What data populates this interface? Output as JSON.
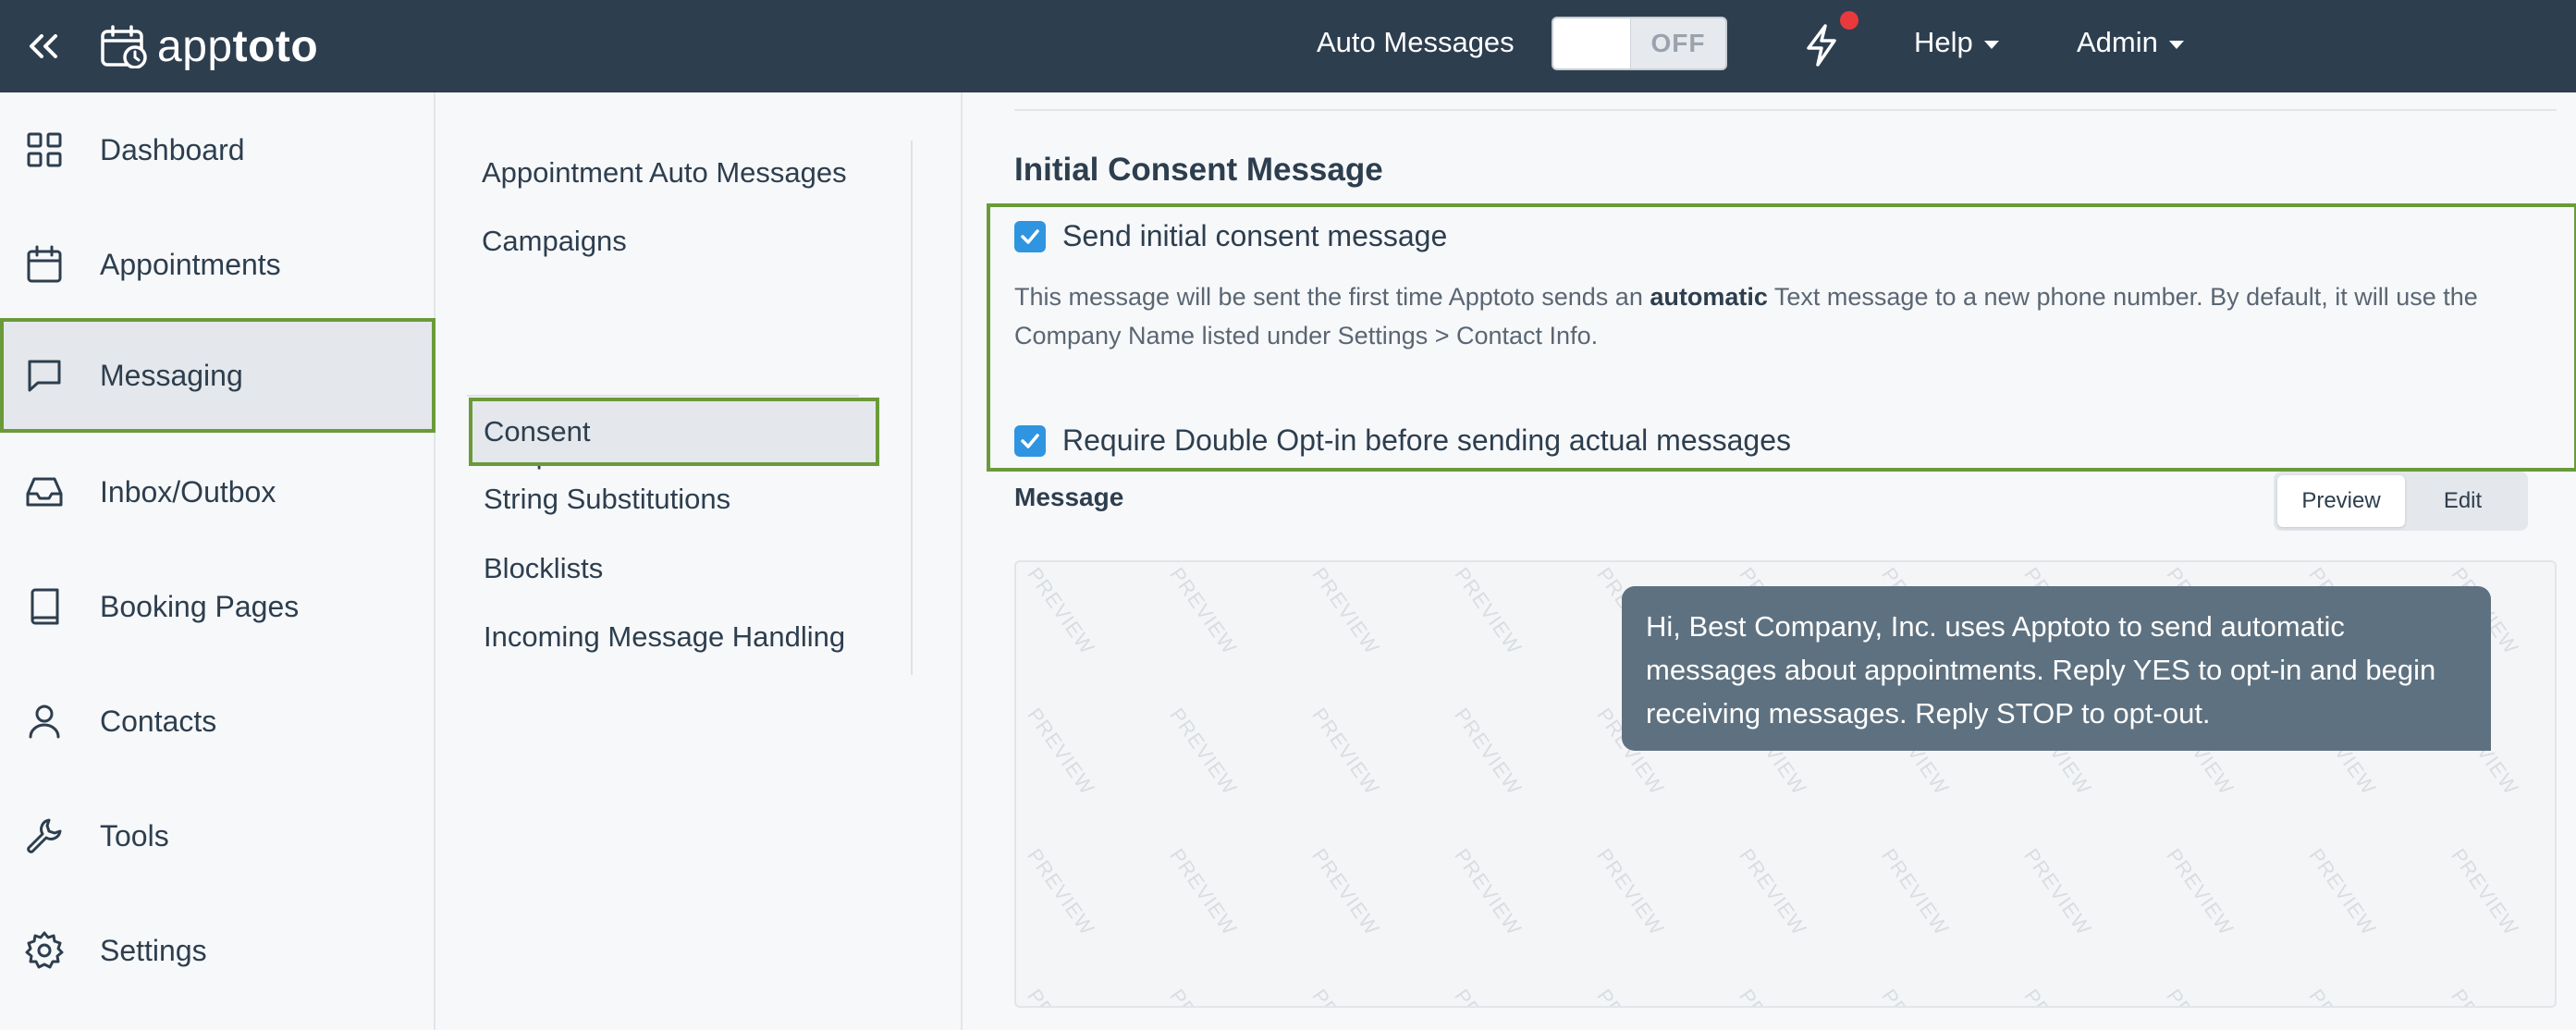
{
  "topbar": {
    "logo_light": "app",
    "logo_bold": "toto",
    "auto_messages_label": "Auto Messages",
    "toggle_state": "OFF",
    "help_label": "Help",
    "admin_label": "Admin"
  },
  "sidebar": {
    "items": [
      {
        "label": "Dashboard",
        "icon": "dashboard-icon"
      },
      {
        "label": "Appointments",
        "icon": "calendar-icon"
      },
      {
        "label": "Messaging",
        "icon": "message-icon",
        "active": true
      },
      {
        "label": "Inbox/Outbox",
        "icon": "inbox-icon"
      },
      {
        "label": "Booking Pages",
        "icon": "book-icon"
      },
      {
        "label": "Contacts",
        "icon": "user-icon"
      },
      {
        "label": "Tools",
        "icon": "wrench-icon"
      },
      {
        "label": "Settings",
        "icon": "gear-icon"
      }
    ]
  },
  "subnav": {
    "items": [
      {
        "label": "Appointment Auto Messages"
      },
      {
        "label": "Campaigns"
      },
      {
        "label": "Templates"
      },
      {
        "label": "Consent",
        "active": true
      },
      {
        "label": "String Substitutions"
      },
      {
        "label": "Blocklists"
      },
      {
        "label": "Incoming Message Handling"
      }
    ]
  },
  "main": {
    "section_title": "Initial Consent Message",
    "send_initial_label": "Send initial consent message",
    "send_initial_checked": true,
    "help_prefix": "This message will be sent the first time Apptoto sends an ",
    "help_bold": "automatic",
    "help_suffix": " Text message to a new phone number. By default, it will use the Company Name listed under Settings > Contact Info.",
    "double_optin_label": "Require Double Opt-in before sending actual messages",
    "double_optin_checked": true,
    "message_label": "Message",
    "tab_preview": "Preview",
    "tab_edit": "Edit",
    "watermark_text": "PREVIEW",
    "preview_message": "Hi, Best Company, Inc. uses Apptoto to send automatic messages about appointments. Reply YES to opt-in and begin receiving messages. Reply STOP to opt-out."
  },
  "colors": {
    "topbar_bg": "#2d3e4f",
    "highlight_border": "#6a9a3a",
    "checkbox_blue": "#2f95e0",
    "bubble_bg": "#5e7180",
    "notification_red": "#e8393d"
  }
}
